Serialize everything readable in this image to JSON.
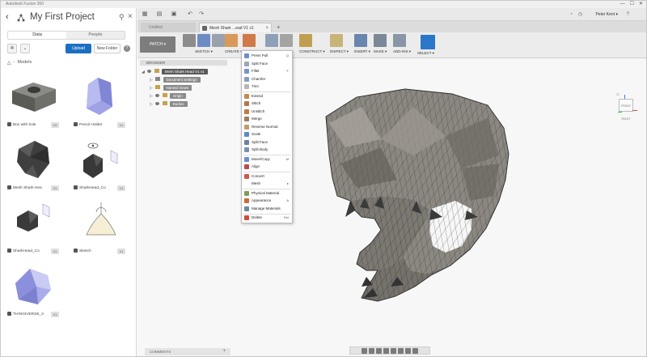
{
  "window": {
    "title": "Autodesk Fusion 360",
    "controls": [
      "—",
      "☐",
      "✕"
    ]
  },
  "data_panel": {
    "project_title": "My First Project",
    "tabs": [
      {
        "label": "Data",
        "active": true
      },
      {
        "label": "People",
        "active": false
      }
    ],
    "upload_label": "Upload",
    "new_folder_label": "New Folder",
    "breadcrumb": "Models",
    "items": [
      {
        "name": "Box with hole",
        "version": "V2"
      },
      {
        "name": "Pencil Holder",
        "version": "V1"
      },
      {
        "name": "Mesh Shark Hea",
        "version": "V1"
      },
      {
        "name": "SharkHead_Co",
        "version": "V1"
      },
      {
        "name": "SharkHead_Co",
        "version": "V1"
      },
      {
        "name": "Sketch",
        "version": "V1"
      },
      {
        "name": "THINGIVERSE_3",
        "version": "V1"
      }
    ]
  },
  "qat": {
    "user_label": "Peter Kent ▾",
    "icons": [
      "grid-icon",
      "file-icon",
      "save-icon",
      "undo-icon",
      "redo-icon"
    ]
  },
  "tabs": {
    "inactive_label": "Untitled",
    "active_label": "Mesh Shark ...ead V1 v1",
    "plus": "+"
  },
  "toolbar": {
    "workspace": "PATCH ▾",
    "groups": [
      {
        "label": "SKETCH ▾",
        "active": false
      },
      {
        "label": "CREATE ▾",
        "active": false
      },
      {
        "label": "MODIFY ▾",
        "active": true
      },
      {
        "label": "ASSEMBLE ▾",
        "active": false
      },
      {
        "label": "CONSTRUCT ▾",
        "active": false
      },
      {
        "label": "INSPECT ▾",
        "active": false
      },
      {
        "label": "INSERT ▾",
        "active": false
      },
      {
        "label": "MAKE ▾",
        "active": false
      },
      {
        "label": "ADD-INS ▾",
        "active": false
      }
    ],
    "select_label": "SELECT ▾"
  },
  "browser": {
    "header": "BROWSER",
    "rows": [
      {
        "label": "Mesh Shark Head V1 v1",
        "indent": 0,
        "tri": "◢",
        "chip": "dark"
      },
      {
        "label": "Document Settings",
        "indent": 1,
        "tri": "▷",
        "chip": "light"
      },
      {
        "label": "Named Views",
        "indent": 1,
        "tri": "▷",
        "chip": "light"
      },
      {
        "label": "Origin",
        "indent": 1,
        "tri": "▷",
        "chip": "light"
      },
      {
        "label": "Bodies",
        "indent": 1,
        "tri": "▷",
        "chip": "light"
      }
    ]
  },
  "modify_menu": {
    "items": [
      {
        "label": "Press Pull",
        "shortcut": "Q",
        "icon": "press-pull-icon",
        "color": "#6e8ec7"
      },
      {
        "label": "Split Face",
        "shortcut": "",
        "icon": "split-face-icon",
        "color": "#9aa7b8"
      },
      {
        "label": "Fillet",
        "shortcut": "F",
        "icon": "fillet-icon",
        "color": "#7a94c4"
      },
      {
        "label": "Chamfer",
        "shortcut": "",
        "icon": "chamfer-icon",
        "color": "#8a9cc0"
      },
      {
        "label": "Trim",
        "shortcut": "",
        "icon": "trim-icon",
        "color": "#b6b6b6",
        "sep_after": true
      },
      {
        "label": "Extend",
        "shortcut": "",
        "icon": "extend-icon",
        "color": "#c08a50"
      },
      {
        "label": "Stitch",
        "shortcut": "",
        "icon": "stitch-icon",
        "color": "#b0784a"
      },
      {
        "label": "Unstitch",
        "shortcut": "",
        "icon": "unstitch-icon",
        "color": "#c07a46"
      },
      {
        "label": "Merge",
        "shortcut": "",
        "icon": "merge-icon",
        "color": "#a07c60"
      },
      {
        "label": "Reverse Normal",
        "shortcut": "",
        "icon": "reverse-normal-icon",
        "color": "#c49a6a"
      },
      {
        "label": "Scale",
        "shortcut": "",
        "icon": "scale-icon",
        "color": "#5a8cc4"
      },
      {
        "label": "Split Face",
        "shortcut": "",
        "icon": "split-face-2-icon",
        "color": "#6c7fa8"
      },
      {
        "label": "Split Body",
        "shortcut": "",
        "icon": "split-body-icon",
        "color": "#7890b4",
        "sep_after": true
      },
      {
        "label": "Move/Copy",
        "shortcut": "M",
        "icon": "move-icon",
        "color": "#6b8fd0"
      },
      {
        "label": "Align",
        "shortcut": "",
        "icon": "align-icon",
        "color": "#c04a4a",
        "sep_after": true
      },
      {
        "label": "Convert",
        "shortcut": "",
        "icon": "convert-icon",
        "color": "#d0584a"
      },
      {
        "label": "Mesh",
        "shortcut": "▸",
        "icon": "mesh-icon",
        "color": "#ffffff",
        "sep_after": true
      },
      {
        "label": "Physical Material",
        "shortcut": "",
        "icon": "physical-material-icon",
        "color": "#7f9c5a"
      },
      {
        "label": "Appearance",
        "shortcut": "A",
        "icon": "appearance-icon",
        "color": "#c86a3a"
      },
      {
        "label": "Manage Materials",
        "shortcut": "",
        "icon": "manage-materials-icon",
        "color": "#6a8a9c",
        "sep_after": true
      },
      {
        "label": "Delete",
        "shortcut": "Del",
        "icon": "delete-icon",
        "color": "#d04a3a"
      }
    ]
  },
  "comments": {
    "label": "COMMENTS",
    "plus": "+"
  },
  "viewcube": {
    "face": "FRONT RIGHT"
  },
  "nav_icons": [
    "orbit-icon",
    "look-at-icon",
    "pan-icon",
    "zoom-icon",
    "fit-icon",
    "display-settings-icon",
    "grid-settings-icon",
    "viewports-icon"
  ]
}
